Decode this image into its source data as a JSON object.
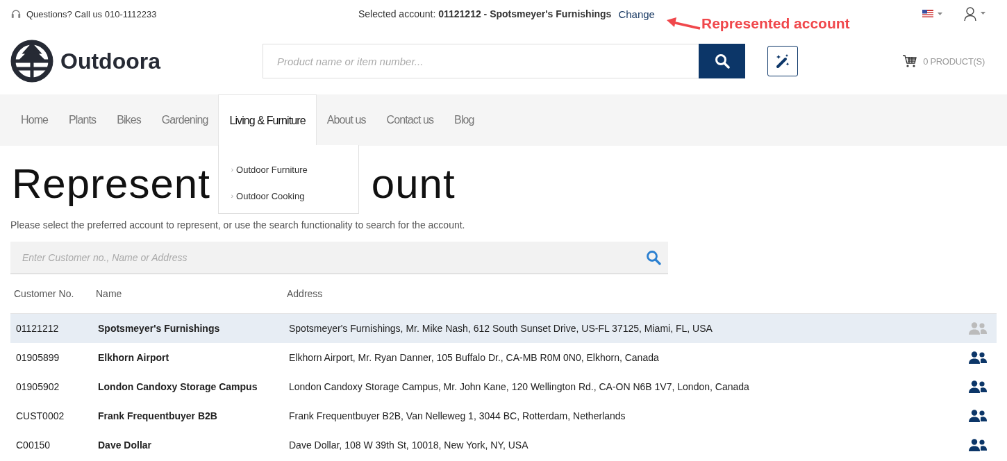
{
  "top_bar": {
    "phone_text": "Questions? Call us 010-1112233",
    "selected_account_label": "Selected account:",
    "selected_account_value": "01121212 - Spotsmeyer's Furnishings",
    "change_link": "Change"
  },
  "annotation": {
    "text": "Represented account"
  },
  "header": {
    "logo_text": "Outdoora",
    "search": {
      "placeholder": "Product name or item number..."
    },
    "cart": "0 PRODUCT(S)"
  },
  "nav": [
    {
      "label": "Home",
      "selected": false
    },
    {
      "label": "Plants",
      "selected": false
    },
    {
      "label": "Bikes",
      "selected": false
    },
    {
      "label": "Gardening",
      "selected": false
    },
    {
      "label": "Living & Furniture",
      "selected": true,
      "children": [
        {
          "marker": "›",
          "label": "Outdoor Furniture"
        },
        {
          "marker": "›",
          "label": "Outdoor Cooking"
        }
      ]
    },
    {
      "label": "About us",
      "selected": false
    },
    {
      "label": "Contact us",
      "selected": false
    },
    {
      "label": "Blog",
      "selected": false
    }
  ],
  "page": {
    "heading_parts": [
      "Represent",
      "ount"
    ],
    "intro": "Please select the preferred account to represent, or use the search functionality to search for the account.",
    "search": {
      "placeholder": "Enter Customer no., Name or Address"
    }
  },
  "table": {
    "columns": [
      "Customer No.",
      "Name",
      "Address"
    ],
    "rows": [
      {
        "customer_no": "01121212",
        "name": "Spotsmeyer's Furnishings",
        "address": "Spotsmeyer's Furnishings, Mr. Mike Nash, 612 South Sunset Drive, US-FL 37125, Miami, FL, USA",
        "selected": true
      },
      {
        "customer_no": "01905899",
        "name": "Elkhorn Airport",
        "address": "Elkhorn Airport, Mr. Ryan Danner, 105 Buffalo Dr., CA-MB R0M 0N0, Elkhorn, Canada",
        "selected": false
      },
      {
        "customer_no": "01905902",
        "name": "London Candoxy Storage Campus",
        "address": "London Candoxy Storage Campus, Mr. John Kane, 120 Wellington Rd., CA-ON N6B 1V7, London, Canada",
        "selected": false
      },
      {
        "customer_no": "CUST0002",
        "name": "Frank Frequentbuyer B2B",
        "address": "Frank Frequentbuyer B2B, Van Nelleweg 1, 3044 BC, Rotterdam, Netherlands",
        "selected": false
      },
      {
        "customer_no": "C00150",
        "name": "Dave Dollar",
        "address": "Dave Dollar, 108 W 39th St, 10018, New York, NY, USA",
        "selected": false
      }
    ]
  }
}
